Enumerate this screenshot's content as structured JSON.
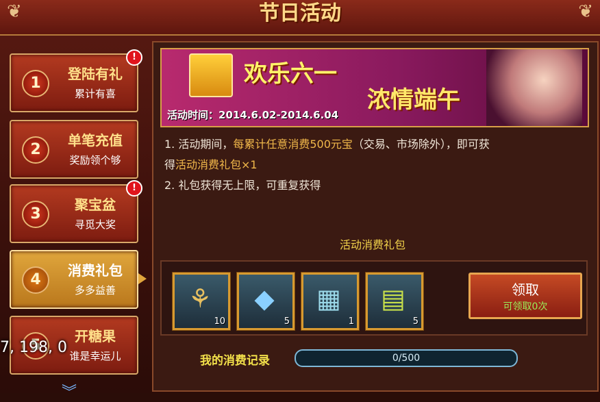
{
  "header": {
    "title": "节日活动"
  },
  "sidebar": {
    "items": [
      {
        "num": "1",
        "title": "登陆有礼",
        "sub": "累计有喜",
        "badge": "!"
      },
      {
        "num": "2",
        "title": "单笔充值",
        "sub": "奖励领个够",
        "badge": ""
      },
      {
        "num": "3",
        "title": "聚宝盆",
        "sub": "寻觅大奖",
        "badge": "!"
      },
      {
        "num": "4",
        "title": "消费礼包",
        "sub": "多多益善",
        "badge": ""
      },
      {
        "num": "5",
        "title": "开糖果",
        "sub": "谁是幸运儿",
        "badge": ""
      }
    ],
    "active_index": 3,
    "overlay_text": "7, 198, 0"
  },
  "banner": {
    "line1": "欢乐六一",
    "line2": "浓情端午",
    "date": "活动时间：2014.6.02-2014.6.04"
  },
  "description": {
    "line1_prefix": "1. 活动期间，",
    "line1_highlight": "每累计任意消费500元宝",
    "line1_suffix": "（交易、市场除外），即可获",
    "line2_prefix": "得",
    "line2_highlight": "活动消费礼包×1",
    "line3": "2. 礼包获得无上限，可重复获得"
  },
  "pack": {
    "title": "活动消费礼包",
    "items": [
      {
        "icon": "dragonfly-icon",
        "glyph": "⚘",
        "qty": "10"
      },
      {
        "icon": "blue-gem-icon",
        "glyph": "◆",
        "qty": "5"
      },
      {
        "icon": "scroll-icon",
        "glyph": "▦",
        "qty": "1"
      },
      {
        "icon": "voucher-icon",
        "glyph": "▤",
        "qty": "5"
      }
    ],
    "claim_label": "领取",
    "claim_sub": "可领取0次"
  },
  "record": {
    "label": "我的消费记录",
    "progress_text": "0/500",
    "progress_fraction": 0
  },
  "colors": {
    "accent_gold": "#f1b84a",
    "claim_green": "#9aee5a"
  }
}
